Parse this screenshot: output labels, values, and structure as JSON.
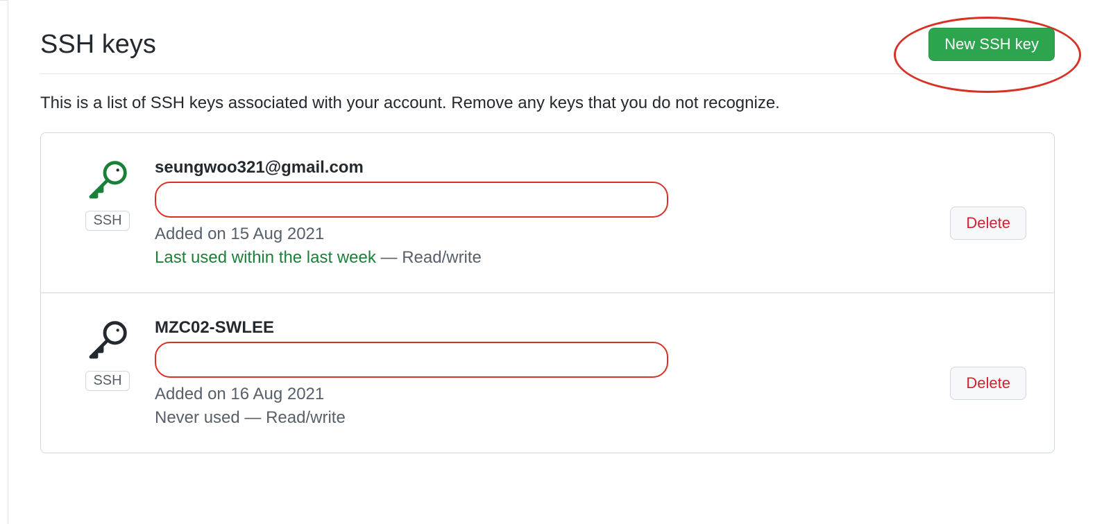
{
  "header": {
    "title": "SSH keys",
    "new_button": "New SSH key"
  },
  "description": "This is a list of SSH keys associated with your account. Remove any keys that you do not recognize.",
  "keys": [
    {
      "title": "seungwoo321@gmail.com",
      "badge": "SSH",
      "added": "Added on 15 Aug 2021",
      "usage": "Last used within the last week",
      "usage_green": true,
      "permission": "Read/write",
      "icon_color": "green",
      "delete_label": "Delete"
    },
    {
      "title": "MZC02-SWLEE",
      "badge": "SSH",
      "added": "Added on 16 Aug 2021",
      "usage": "Never used",
      "usage_green": false,
      "permission": "Read/write",
      "icon_color": "black",
      "delete_label": "Delete"
    }
  ]
}
